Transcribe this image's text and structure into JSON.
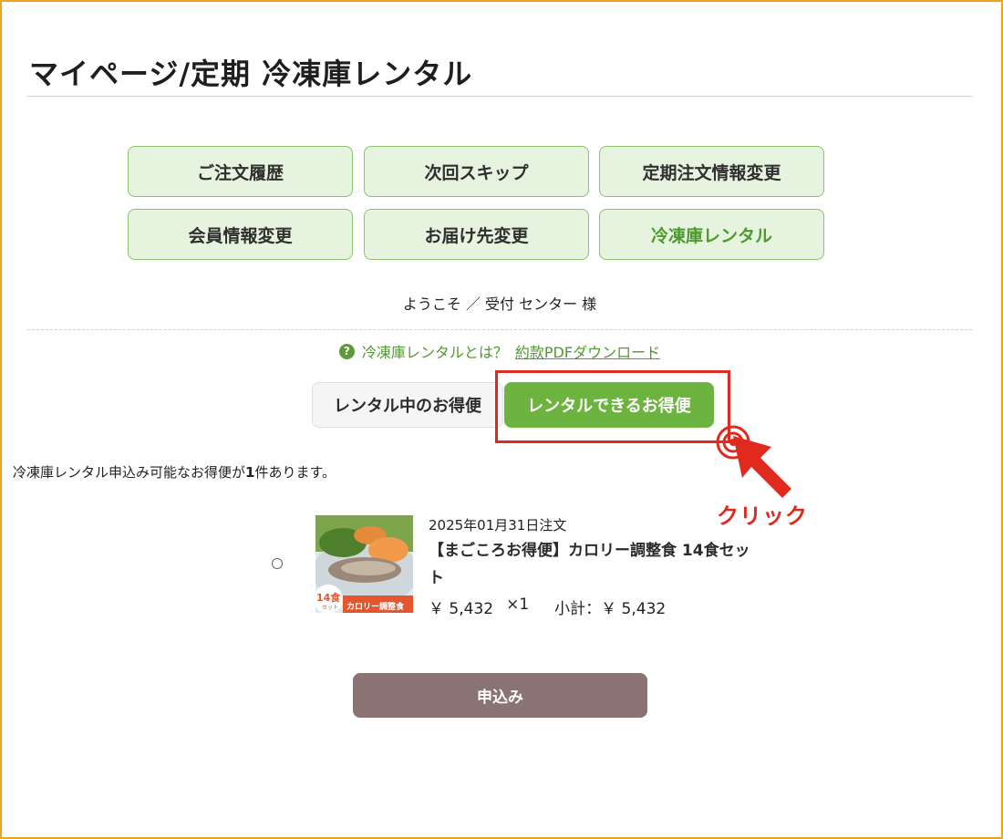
{
  "page": {
    "title": "マイページ/定期 冷凍庫レンタル",
    "frame_color": "#f0a31c"
  },
  "nav": {
    "buttons": [
      {
        "label": "ご注文履歴"
      },
      {
        "label": "次回スキップ"
      },
      {
        "label": "定期注文情報変更"
      },
      {
        "label": "会員情報変更"
      },
      {
        "label": "お届け先変更"
      },
      {
        "label": "冷凍庫レンタル",
        "active": true
      }
    ],
    "accent_color": "#8ac36c"
  },
  "welcome": "ようこそ ／ 受付 センター 様",
  "info": {
    "help_icon": "question-circle-icon",
    "help_text": "冷凍庫レンタルとは？",
    "pdf_link": "約款PDFダウンロード"
  },
  "tabs": {
    "inactive_label": "レンタル中のお得便",
    "active_label": "レンタルできるお得便",
    "active_color": "#6db33f"
  },
  "annotation": {
    "click_label": "クリック",
    "color": "#e02a1f"
  },
  "list": {
    "count_prefix": "冷凍庫レンタル申込み可能なお得便が",
    "count_value": "1",
    "count_suffix": "件あります。"
  },
  "item": {
    "order_date": "2025年01月31日注文",
    "name": "【まごころお得便】カロリー調整食 14食セット",
    "price": "￥ 5,432",
    "quantity": "×1",
    "subtotal": "小計：￥ 5,432",
    "badge_count": "14食",
    "badge_sub": "セット",
    "banner_text": "カロリー調整食"
  },
  "apply_button": {
    "label": "申込み",
    "color": "#8a7372"
  }
}
